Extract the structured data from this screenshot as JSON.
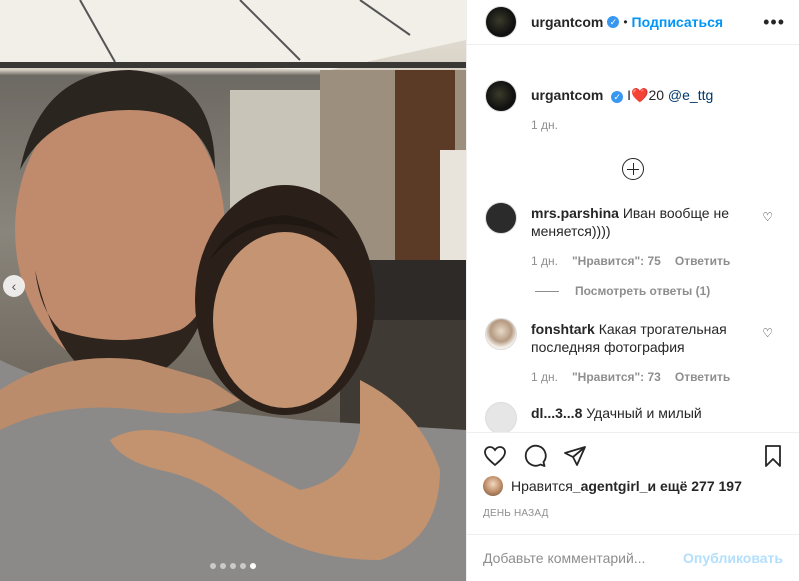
{
  "header": {
    "username": "urgantcom",
    "separator": "•",
    "follow_label": "Подписаться",
    "more": "•••"
  },
  "caption": {
    "username": "urgantcom",
    "text_prefix": "I",
    "heart": "❤️",
    "text_mid": "20 ",
    "mention": "@e_ttg",
    "time": "1 дн."
  },
  "comments": [
    {
      "username": "mrs.parshina",
      "text": "Иван вообще не меняется))))",
      "time": "1 дн.",
      "likes": "\"Нравится\": 75",
      "reply": "Ответить",
      "view_replies": "Посмотреть ответы (1)"
    },
    {
      "username": "fonshtark",
      "text": "Какая трогательная последняя фотография",
      "time": "1 дн.",
      "likes": "\"Нравится\": 73",
      "reply": "Ответить"
    },
    {
      "username": "dl...3...8",
      "text": "Удачный и милый"
    }
  ],
  "likes": {
    "prefix": "Нравится ",
    "user": "_agentgirl_",
    "suffix": " и ещё 277 197"
  },
  "date_label": "ДЕНЬ НАЗАД",
  "add_comment": {
    "placeholder": "Добавьте комментарий...",
    "post_label": "Опубликовать"
  },
  "carousel": {
    "dots": 5,
    "active_index": 4
  },
  "icons": {
    "verified": "verified-badge-icon",
    "heart": "heart-icon",
    "comment": "comment-icon",
    "share": "share-icon",
    "save": "bookmark-icon"
  },
  "colors": {
    "accent": "#0095f6",
    "verified": "#3897f0",
    "heart": "#ed4956",
    "muted": "#8e8e8e"
  }
}
